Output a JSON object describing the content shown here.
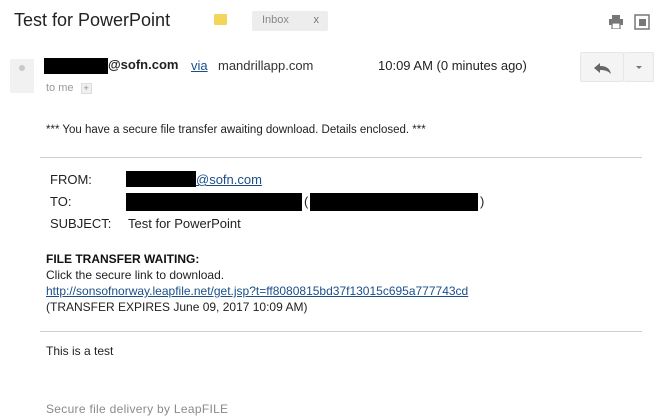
{
  "subject": {
    "title": "Test for PowerPoint",
    "label_chip": "Inbox",
    "label_chip_close": "x",
    "importance_color": "#f2d65a"
  },
  "sender": {
    "domain": "@sofn.com",
    "via": "via",
    "via_host": "mandrillapp.com",
    "timestamp": "10:09 AM (0 minutes ago)",
    "recipient_line": "to me",
    "recipient_expand": "+"
  },
  "message": {
    "banner": "*** You have a secure file transfer awaiting download. Details enclosed. ***",
    "headers": {
      "from_label": "FROM:",
      "from_domain": "@sofn.com",
      "to_label": "TO:",
      "to_open_paren": "(",
      "to_close_paren": ")",
      "subject_label": "SUBJECT:",
      "subject_value": "Test for PowerPoint"
    },
    "file_transfer": {
      "heading": "FILE TRANSFER WAITING:",
      "instruction": "Click the secure link to download.",
      "link": "http://sonsofnorway.leapfile.net/get.jsp?t=ff8080815bd37f13015c695a777743cd",
      "expiry": "(TRANSFER EXPIRES June 09, 2017 10:09 AM)"
    },
    "body": "This is a test",
    "footer": "Secure file delivery by LeapFILE"
  },
  "icons": {
    "print": "print-icon",
    "popout": "popout-icon",
    "reply": "reply-icon",
    "more": "chevron-down-icon"
  }
}
